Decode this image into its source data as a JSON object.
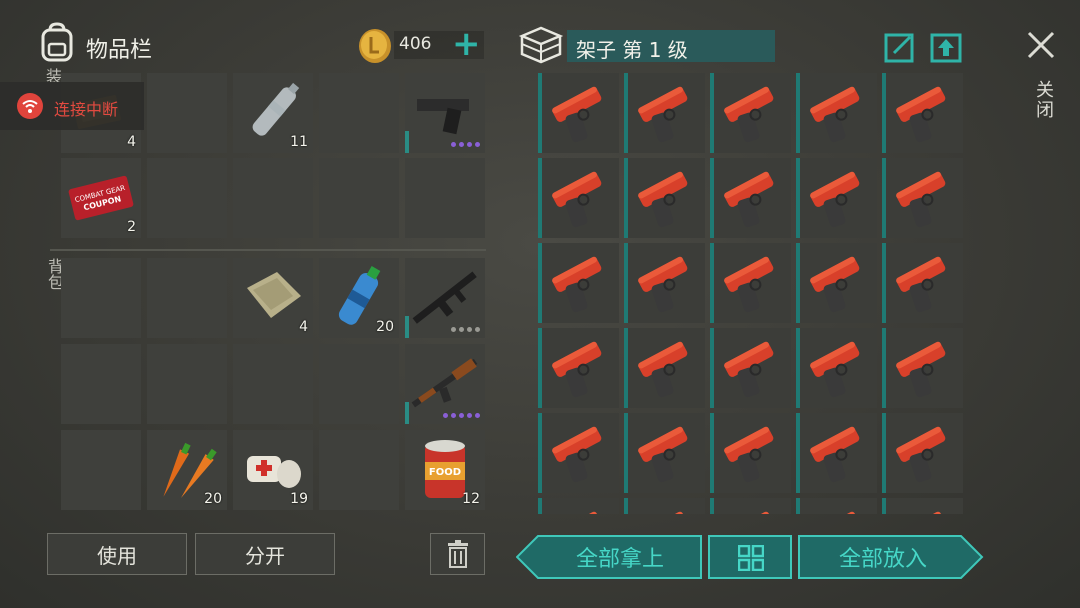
{
  "header": {
    "inventory_title": "物品栏",
    "coins": "406",
    "add_label": "+",
    "shelf_title": "架子 第 1 级",
    "close_label": "关闭"
  },
  "side_labels": {
    "backpack": "背包",
    "equip": "装"
  },
  "notice": {
    "text": "连接中断"
  },
  "left_slots": [
    {
      "row": 0,
      "col": 0,
      "item": "ticket-gold",
      "count": "4"
    },
    {
      "row": 0,
      "col": 1,
      "item": "empty",
      "count": ""
    },
    {
      "row": 0,
      "col": 2,
      "item": "water-bottle-empty",
      "count": "11"
    },
    {
      "row": 0,
      "col": 3,
      "item": "empty",
      "count": ""
    },
    {
      "row": 0,
      "col": 4,
      "item": "pistol",
      "count": "",
      "durability": "purple-4"
    },
    {
      "row": 1,
      "col": 0,
      "item": "combat-gear-coupon",
      "count": "2"
    },
    {
      "row": 1,
      "col": 1,
      "item": "empty",
      "count": ""
    },
    {
      "row": 1,
      "col": 2,
      "item": "empty",
      "count": ""
    },
    {
      "row": 1,
      "col": 3,
      "item": "empty",
      "count": ""
    },
    {
      "row": 1,
      "col": 4,
      "item": "empty",
      "count": ""
    },
    {
      "row": 2,
      "col": 0,
      "item": "empty",
      "count": ""
    },
    {
      "row": 2,
      "col": 1,
      "item": "empty",
      "count": ""
    },
    {
      "row": 2,
      "col": 2,
      "item": "cloth-sack",
      "count": "4"
    },
    {
      "row": 2,
      "col": 3,
      "item": "water-bottle",
      "count": "20"
    },
    {
      "row": 2,
      "col": 4,
      "item": "m16-rifle",
      "count": "",
      "durability": "gray-4"
    },
    {
      "row": 3,
      "col": 0,
      "item": "empty",
      "count": ""
    },
    {
      "row": 3,
      "col": 1,
      "item": "empty",
      "count": ""
    },
    {
      "row": 3,
      "col": 2,
      "item": "empty",
      "count": ""
    },
    {
      "row": 3,
      "col": 3,
      "item": "empty",
      "count": ""
    },
    {
      "row": 3,
      "col": 4,
      "item": "ak-rifle",
      "count": "",
      "durability": "purple-5"
    },
    {
      "row": 4,
      "col": 0,
      "item": "empty",
      "count": ""
    },
    {
      "row": 4,
      "col": 1,
      "item": "carrots",
      "count": "20"
    },
    {
      "row": 4,
      "col": 2,
      "item": "bandage",
      "count": "19"
    },
    {
      "row": 4,
      "col": 3,
      "item": "empty",
      "count": ""
    },
    {
      "row": 4,
      "col": 4,
      "item": "canned-food",
      "count": "12"
    }
  ],
  "shelf_item": "flare-gun",
  "shelf_rows": 6,
  "shelf_cols": 5,
  "buttons": {
    "use": "使用",
    "split": "分开",
    "take_all": "全部拿上",
    "put_all": "全部放入"
  },
  "colors": {
    "accent": "#2fb4a8",
    "teal_dark": "#2a5a5a",
    "alert": "#e34a40",
    "purple_dot": "#8a5fd6"
  }
}
